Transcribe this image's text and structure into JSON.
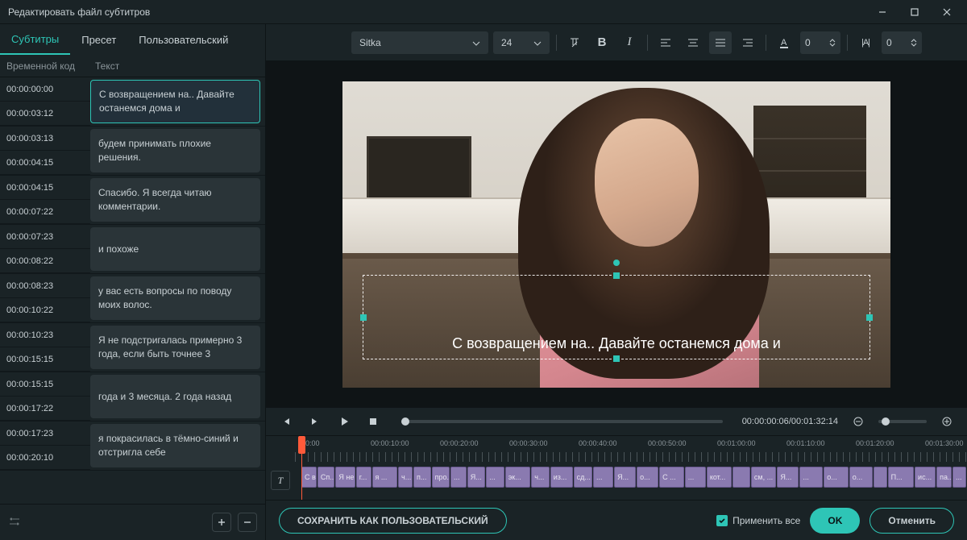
{
  "window": {
    "title": "Редактировать файл субтитров"
  },
  "tabs": {
    "t0": "Субтитры",
    "t1": "Пресет",
    "t2": "Пользовательский"
  },
  "listHeader": {
    "time": "Временной код",
    "text": "Текст"
  },
  "subs": [
    {
      "start": "00:00:00:00",
      "end": "00:00:03:12",
      "text": "С возвращением на.. Давайте останемся дома и",
      "selected": true
    },
    {
      "start": "00:00:03:13",
      "end": "00:00:04:15",
      "text": "будем принимать плохие решения."
    },
    {
      "start": "00:00:04:15",
      "end": "00:00:07:22",
      "text": "Спасибо. Я всегда читаю комментарии."
    },
    {
      "start": "00:00:07:23",
      "end": "00:00:08:22",
      "text": "и похоже"
    },
    {
      "start": "00:00:08:23",
      "end": "00:00:10:22",
      "text": "у вас есть вопросы по поводу моих волос."
    },
    {
      "start": "00:00:10:23",
      "end": "00:00:15:15",
      "text": "Я не подстригалась примерно 3 года, если быть точнее 3"
    },
    {
      "start": "00:00:15:15",
      "end": "00:00:17:22",
      "text": "года и 3 месяца. 2 года назад"
    },
    {
      "start": "00:00:17:23",
      "end": "00:00:20:10",
      "text": "я покрасилась в тёмно-синий и отстригла себе"
    }
  ],
  "toolbar": {
    "font": "Sitka",
    "size": "24",
    "letterSpacing": "0",
    "lineHeight": "0"
  },
  "previewSubtitle": "С возвращением на.. Давайте останемся дома и",
  "playback": {
    "current": "00:00:00:06",
    "total": "00:01:32:14"
  },
  "ruler": [
    "00:00",
    "00:00:10:00",
    "00:00:20:00",
    "00:00:30:00",
    "00:00:40:00",
    "00:00:50:00",
    "00:01:00:00",
    "00:01:10:00",
    "00:01:20:00",
    "00:01:30:00"
  ],
  "clips": [
    "С в...",
    "Сп...",
    "Я не ...",
    "г...",
    "я ...",
    "ч...",
    "п...",
    "про...",
    "...",
    "Я...",
    "...",
    "эк...",
    "ч...",
    "из...",
    "сд...",
    "...",
    "Я...",
    "о...",
    "С ...",
    "...",
    "кот...",
    "",
    "см, ...",
    "Я...",
    "...",
    "о...",
    "о...",
    "",
    "П...",
    "ис...",
    "па...",
    "..."
  ],
  "footer": {
    "save": "СОХРАНИТЬ КАК ПОЛЬЗОВАТЕЛЬСКИЙ",
    "applyAll": "Применить все",
    "ok": "OK",
    "cancel": "Отменить"
  }
}
